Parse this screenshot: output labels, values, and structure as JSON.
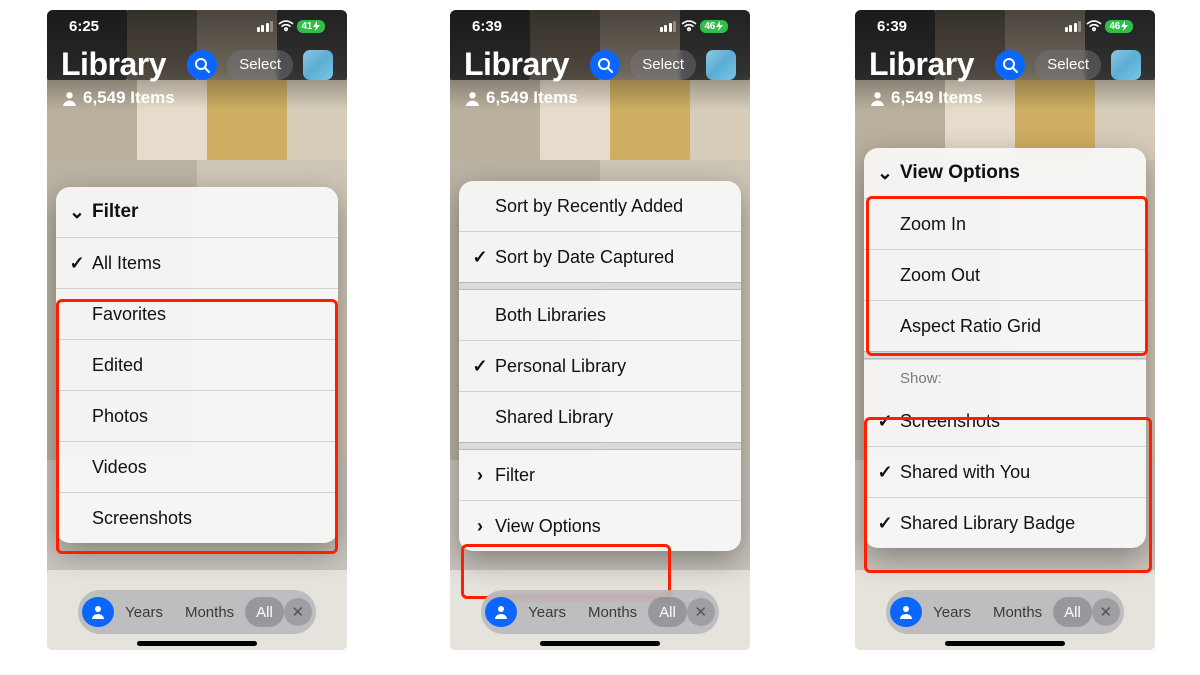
{
  "screens": [
    {
      "time": "6:25",
      "battery": "41",
      "title": "Library",
      "item_count_label": "6,549 Items",
      "select_label": "Select",
      "menu": {
        "header": "Filter",
        "header_glyph": "chevron-down",
        "items": [
          {
            "label": "All Items",
            "checked": true
          },
          {
            "label": "Favorites",
            "checked": false
          },
          {
            "label": "Edited",
            "checked": false
          },
          {
            "label": "Photos",
            "checked": false
          },
          {
            "label": "Videos",
            "checked": false
          },
          {
            "label": "Screenshots",
            "checked": false
          }
        ]
      },
      "segments": {
        "years": "Years",
        "months": "Months",
        "all": "All"
      }
    },
    {
      "time": "6:39",
      "battery": "46",
      "title": "Library",
      "item_count_label": "6,549 Items",
      "select_label": "Select",
      "menu": {
        "groups": [
          [
            {
              "label": "Sort by Recently Added",
              "checked": false
            },
            {
              "label": "Sort by Date Captured",
              "checked": true
            }
          ],
          [
            {
              "label": "Both Libraries",
              "checked": false
            },
            {
              "label": "Personal Library",
              "checked": true
            },
            {
              "label": "Shared Library",
              "checked": false
            }
          ],
          [
            {
              "label": "Filter",
              "glyph": "chevron-right"
            },
            {
              "label": "View Options",
              "glyph": "chevron-right"
            }
          ]
        ]
      },
      "segments": {
        "years": "Years",
        "months": "Months",
        "all": "All"
      }
    },
    {
      "time": "6:39",
      "battery": "46",
      "title": "Library",
      "item_count_label": "6,549 Items",
      "select_label": "Select",
      "menu": {
        "header": "View Options",
        "header_glyph": "chevron-down",
        "items_a": [
          {
            "label": "Zoom In"
          },
          {
            "label": "Zoom Out"
          },
          {
            "label": "Aspect Ratio Grid"
          }
        ],
        "show_label": "Show:",
        "items_b": [
          {
            "label": "Screenshots",
            "checked": true
          },
          {
            "label": "Shared with You",
            "checked": true
          },
          {
            "label": "Shared Library Badge",
            "checked": true
          }
        ]
      },
      "segments": {
        "years": "Years",
        "months": "Months",
        "all": "All"
      }
    }
  ]
}
